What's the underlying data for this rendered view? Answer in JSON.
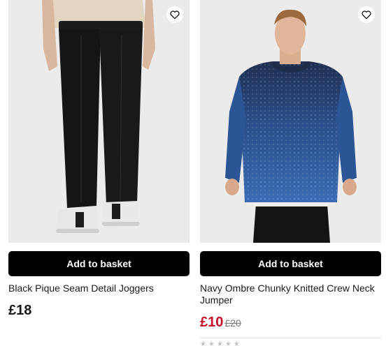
{
  "products": [
    {
      "title": "Black Pique Seam Detail Joggers",
      "price": "£18",
      "add_button": "Add to basket",
      "wishlist_icon": "heart-outline-icon",
      "image": "black-joggers-photo"
    },
    {
      "title": "Navy Ombre Chunky Knitted Crew Neck Jumper",
      "price_now": "£10",
      "price_was": "£20",
      "add_button": "Add to basket",
      "wishlist_icon": "heart-outline-icon",
      "image": "navy-jumper-photo",
      "rating_stars": [
        "★",
        "★",
        "★",
        "★",
        "★"
      ]
    }
  ],
  "colors": {
    "button_bg": "#000000",
    "button_text": "#ffffff",
    "sale_price": "#c8102e",
    "image_bg": "#ebebeb"
  }
}
